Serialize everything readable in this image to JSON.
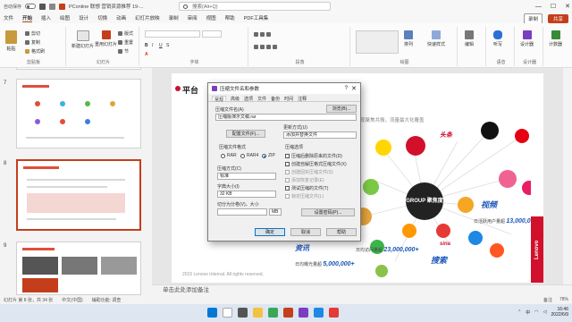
{
  "titlebar": {
    "autosave": "自动保存",
    "doc_title": "PConline 联想 营销资源推荐 19-...",
    "search_placeholder": "搜索(Alt+Q)",
    "minimize": "—",
    "maximize": "☐",
    "close": "✕"
  },
  "ribbon_tabs": [
    "文件",
    "开始",
    "插入",
    "绘图",
    "设计",
    "切换",
    "动画",
    "幻灯片放映",
    "录制",
    "审阅",
    "视图",
    "帮助",
    "PDF工具集"
  ],
  "ribbon_right": {
    "record": "录制",
    "share": "共享"
  },
  "ribbon": {
    "paste": "粘贴",
    "cut": "剪切",
    "copy": "复制",
    "format_painter": "格式刷",
    "clipboard_label": "剪贴板",
    "new_slide": "新建幻灯片",
    "reuse_slide": "重用幻灯片",
    "layout": "版式",
    "reset": "重置",
    "section": "节",
    "slides_label": "幻灯片",
    "font_label": "字体",
    "paragraph_label": "段落",
    "drawing_label": "绘图",
    "arrange": "排列",
    "quick_styles": "快速样式",
    "editing": "编辑",
    "dictate": "听写",
    "designer": "设计器",
    "voice_label": "语音",
    "designer_label": "设计器",
    "count": "计数器"
  },
  "thumbnails": {
    "nums": [
      "7",
      "8",
      "9"
    ]
  },
  "slide": {
    "title": "平台",
    "subtitle": "，实现聚焦共振，流量最大化覆盖",
    "hub": "GROUP\n聚焦度",
    "brands": {
      "toutiao": "头条",
      "weishi": "视频",
      "sina": "sina",
      "search": "搜索",
      "video": "资讯",
      "news": "腾讯"
    },
    "stats": [
      {
        "pre": "日活跃用户量超",
        "num": "13,000,000+"
      },
      {
        "pre": "日均访问量超",
        "num": "23,000,000+"
      },
      {
        "pre": "日均曝光量超",
        "num": "5,000,000+"
      }
    ],
    "copyright": "2015 Lenovo Internal. All rights reserved.",
    "lenovo": "Lenovo"
  },
  "dialog": {
    "title": "压缩文件名和参数",
    "help": "?",
    "close": "✕",
    "tabs": [
      "常规",
      "高级",
      "选项",
      "文件",
      "备份",
      "时间",
      "注释"
    ],
    "archive_name_label": "压缩文件名(A)",
    "archive_name_value": "压缩版演示文稿.rar",
    "browse_button": "浏览(B)...",
    "default_profile_button": "配置文件(F)...",
    "update_mode_label": "更新方式(U)",
    "update_mode_value": "添加并替换文件",
    "format_label": "压缩文件格式",
    "formats": [
      "RAR",
      "RAR4",
      "ZIP"
    ],
    "selected_format": "ZIP",
    "method_label": "压缩方式(C)",
    "method_value": "标准",
    "dict_label": "字典大小(I)",
    "dict_value": "32 KB",
    "split_label": "切分为分卷(V)，大小",
    "split_unit": "MB",
    "options_label": "压缩选项",
    "options": [
      {
        "label": "压缩后删除原来的文件(D)",
        "disabled": false
      },
      {
        "label": "创建自解压格式压缩文件(X)",
        "disabled": false
      },
      {
        "label": "创建固实压缩文件(S)",
        "disabled": true
      },
      {
        "label": "添加恢复记录(E)",
        "disabled": true
      },
      {
        "label": "测试压缩的文件(T)",
        "disabled": false
      },
      {
        "label": "锁定压缩文件(L)",
        "disabled": true
      }
    ],
    "password_button": "设置密码(P)...",
    "ok": "确定",
    "cancel": "取消",
    "help_button": "帮助"
  },
  "notes": {
    "placeholder": "单击此处添加备注"
  },
  "status": {
    "slide_info": "幻灯片 第 8 张，共 34 张",
    "lang": "中文(中国)",
    "accessibility": "辅助功能: 调查",
    "notes_btn": "备注",
    "zoom": "78%"
  },
  "taskbar": {
    "time": "16:46",
    "date": "2022/6/9",
    "lang": "中"
  }
}
